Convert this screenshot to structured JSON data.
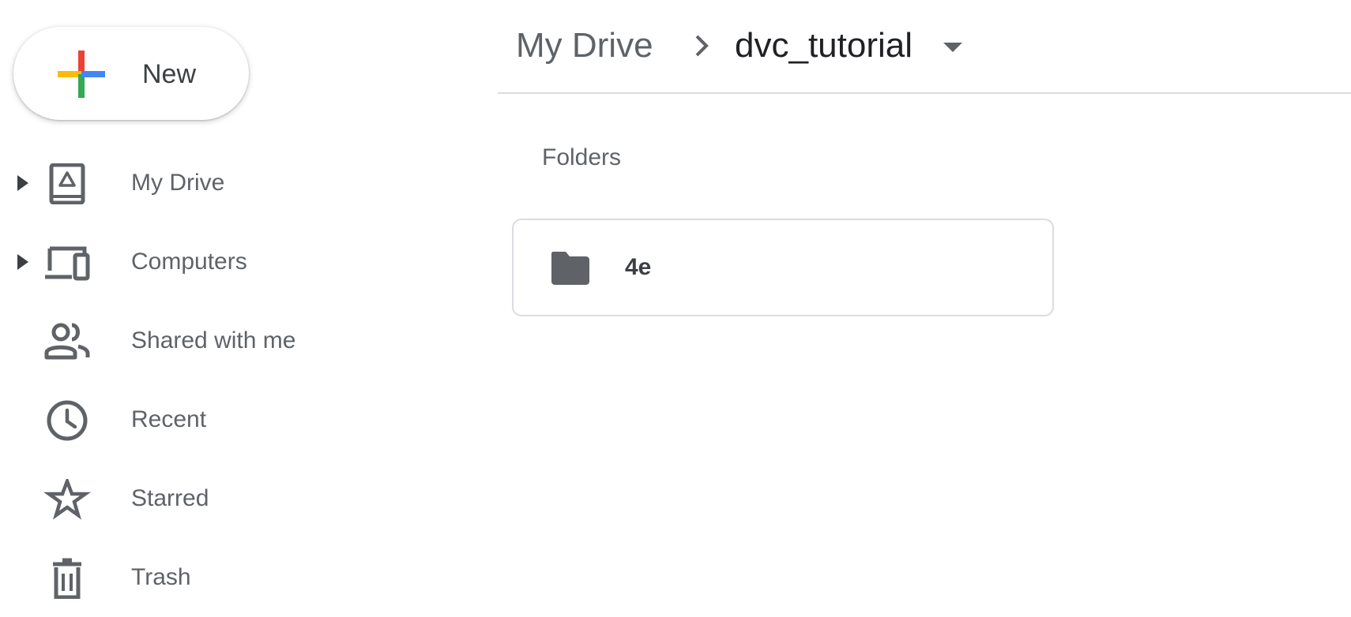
{
  "new_button": {
    "label": "New"
  },
  "sidebar": {
    "items": [
      {
        "label": "My Drive",
        "icon": "drive-icon",
        "expandable": true
      },
      {
        "label": "Computers",
        "icon": "computers-icon",
        "expandable": true
      },
      {
        "label": "Shared with me",
        "icon": "people-icon",
        "expandable": false
      },
      {
        "label": "Recent",
        "icon": "clock-icon",
        "expandable": false
      },
      {
        "label": "Starred",
        "icon": "star-icon",
        "expandable": false
      },
      {
        "label": "Trash",
        "icon": "trash-icon",
        "expandable": false
      }
    ]
  },
  "breadcrumb": {
    "root": "My Drive",
    "current": "dvc_tutorial"
  },
  "main": {
    "section_title": "Folders",
    "folders": [
      {
        "name": "4e",
        "icon": "folder-icon"
      }
    ]
  },
  "colors": {
    "icon_gray": "#5f6368",
    "text_dark": "#202124",
    "divider": "#dadce0",
    "google_red": "#ea4335",
    "google_yellow": "#fbbc04",
    "google_green": "#34a853",
    "google_blue": "#4285f4"
  }
}
